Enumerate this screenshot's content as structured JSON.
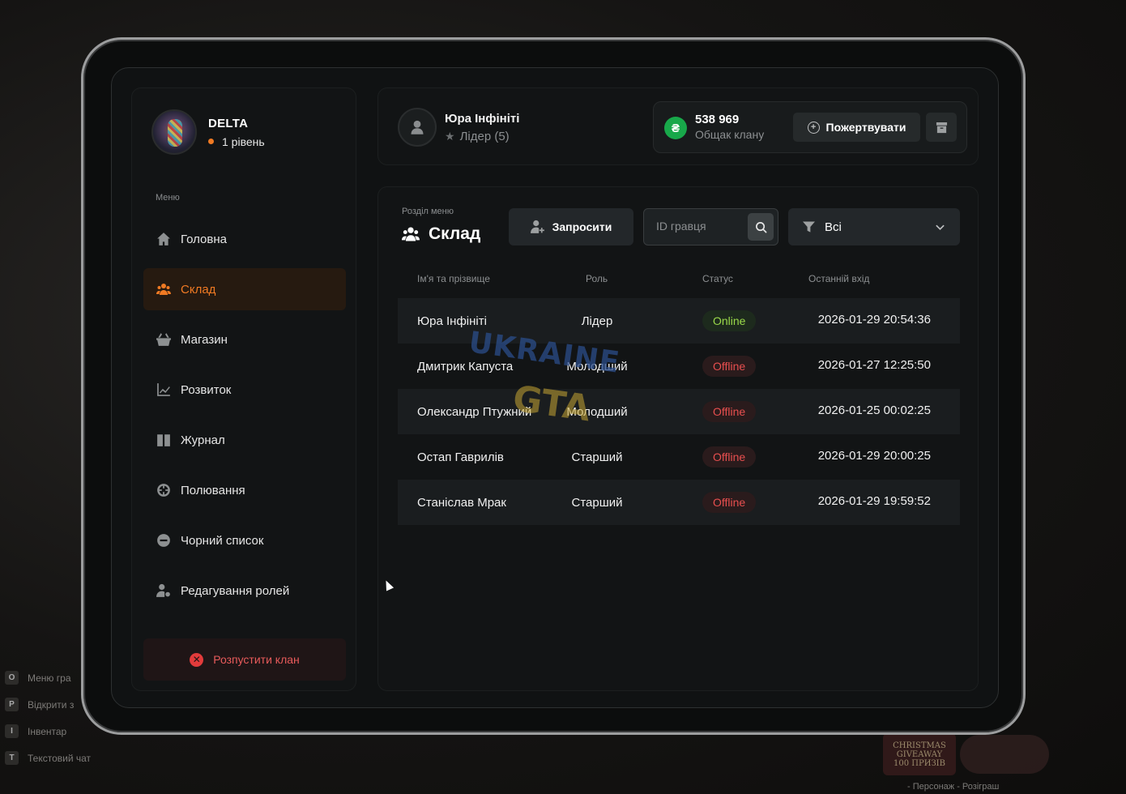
{
  "game_hints": [
    {
      "key": "O",
      "label": "Меню гра"
    },
    {
      "key": "P",
      "label": "Відкрити з"
    },
    {
      "key": "I",
      "label": "Інвентар"
    },
    {
      "key": "T",
      "label": "Текстовий чат"
    }
  ],
  "promo": {
    "text": "CHRISTMAS GIVEAWAY",
    "sub": "100 ПРИЗІВ",
    "hint": "- Персонаж - Розіграш"
  },
  "watermark": {
    "line1": "UKRAINE",
    "line2": "GTA"
  },
  "clan": {
    "name": "DELTA",
    "level": "1 рівень"
  },
  "menu": {
    "title": "Меню",
    "items": [
      {
        "label": "Головна",
        "icon": "home-icon",
        "active": false
      },
      {
        "label": "Склад",
        "icon": "members-icon",
        "active": true
      },
      {
        "label": "Магазин",
        "icon": "shop-basket-icon",
        "active": false
      },
      {
        "label": "Розвиток",
        "icon": "chart-icon",
        "active": false
      },
      {
        "label": "Журнал",
        "icon": "book-icon",
        "active": false
      },
      {
        "label": "Полювання",
        "icon": "crosshair-icon",
        "active": false
      },
      {
        "label": "Чорний список",
        "icon": "minus-circle-icon",
        "active": false
      },
      {
        "label": "Редагування ролей",
        "icon": "user-settings-icon",
        "active": false
      }
    ],
    "disband_label": "Розпустити клан"
  },
  "user": {
    "name": "Юра Інфініті",
    "role": "Лідер (5)"
  },
  "wallet": {
    "balance": "538 969",
    "label": "Общак клану",
    "currency_symbol": "₴",
    "donate_label": "Пожертвувати"
  },
  "section": {
    "label": "Розділ меню",
    "title": "Склад",
    "invite_label": "Запросити",
    "search_placeholder": "ID гравця",
    "filter_value": "Всі"
  },
  "table": {
    "columns": [
      "Ім'я та прізвище",
      "Роль",
      "Статус",
      "Останній вхід"
    ],
    "rows": [
      {
        "name": "Юра Інфініті",
        "role": "Лідер",
        "status": "Online",
        "last_login": "2026-01-29 20:54:36"
      },
      {
        "name": "Дмитрик Капуста",
        "role": "Молодший",
        "status": "Offline",
        "last_login": "2026-01-27 12:25:50"
      },
      {
        "name": "Олександр Птужний",
        "role": "Молодший",
        "status": "Offline",
        "last_login": "2026-01-25 00:02:25"
      },
      {
        "name": "Остап Гаврилів",
        "role": "Старший",
        "status": "Offline",
        "last_login": "2026-01-29 20:00:25"
      },
      {
        "name": "Станіслав Мрак",
        "role": "Старший",
        "status": "Offline",
        "last_login": "2026-01-29 19:59:52"
      }
    ]
  },
  "colors": {
    "accent": "#f07a23",
    "online": "#9ad94a",
    "offline": "#e84f4f",
    "currency": "#18a84a",
    "danger": "#e23b3b"
  }
}
